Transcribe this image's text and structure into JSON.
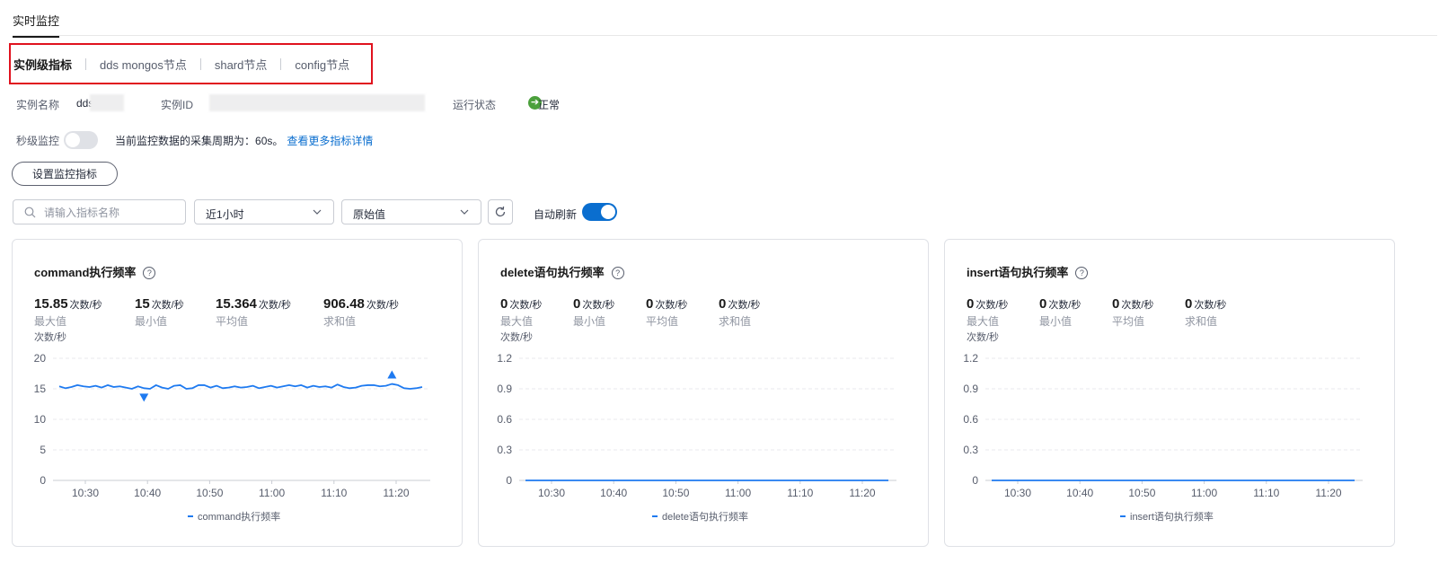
{
  "page_tab": "实时监控",
  "subtabs": [
    "实例级指标",
    "dds mongos节点",
    "shard节点",
    "config节点"
  ],
  "info": {
    "name_label": "实例名称",
    "name_value": "dds",
    "id_label": "实例ID",
    "status_label": "运行状态",
    "status_value": "正常"
  },
  "second_level": {
    "label": "秒级监控",
    "period_text": "当前监控数据的采集周期为：60s。",
    "link_text": "查看更多指标详情"
  },
  "setting_button": "设置监控指标",
  "search": {
    "placeholder": "请输入指标名称"
  },
  "time_select": "近1小时",
  "value_select": "原始值",
  "auto_refresh_label": "自动刷新",
  "colors": {
    "accent": "#0a6ecf",
    "series": "#1e7af0",
    "status_ok": "#4ba03c",
    "highlight_border": "#e0121e"
  },
  "cards": [
    {
      "title": "command执行频率",
      "stats": [
        {
          "value": "15.85",
          "unit": "次数/秒",
          "label": "最大值"
        },
        {
          "value": "15",
          "unit": "次数/秒",
          "label": "最小值"
        },
        {
          "value": "15.364",
          "unit": "次数/秒",
          "label": "平均值"
        },
        {
          "value": "906.48",
          "unit": "次数/秒",
          "label": "求和值"
        }
      ],
      "unit_label": "次数/秒",
      "legend": "command执行频率"
    },
    {
      "title": "delete语句执行频率",
      "stats": [
        {
          "value": "0",
          "unit": "次数/秒",
          "label": "最大值"
        },
        {
          "value": "0",
          "unit": "次数/秒",
          "label": "最小值"
        },
        {
          "value": "0",
          "unit": "次数/秒",
          "label": "平均值"
        },
        {
          "value": "0",
          "unit": "次数/秒",
          "label": "求和值"
        }
      ],
      "unit_label": "次数/秒",
      "legend": "delete语句执行频率"
    },
    {
      "title": "insert语句执行频率",
      "stats": [
        {
          "value": "0",
          "unit": "次数/秒",
          "label": "最大值"
        },
        {
          "value": "0",
          "unit": "次数/秒",
          "label": "最小值"
        },
        {
          "value": "0",
          "unit": "次数/秒",
          "label": "平均值"
        },
        {
          "value": "0",
          "unit": "次数/秒",
          "label": "求和值"
        }
      ],
      "unit_label": "次数/秒",
      "legend": "insert语句执行频率"
    }
  ],
  "chart_data": [
    {
      "type": "line",
      "ylim": [
        0,
        20
      ],
      "yticks": [
        "0",
        "5",
        "10",
        "15",
        "20"
      ],
      "xticks": [
        "10:30",
        "10:40",
        "10:50",
        "11:00",
        "11:10",
        "11:20"
      ],
      "series": [
        {
          "name": "command执行频率",
          "values": [
            15.4,
            15.1,
            15.3,
            15.6,
            15.4,
            15.3,
            15.5,
            15.2,
            15.6,
            15.3,
            15.4,
            15.2,
            15.0,
            15.4,
            15.1,
            15.0,
            15.6,
            15.2,
            15.0,
            15.5,
            15.6,
            15.0,
            15.1,
            15.6,
            15.6,
            15.2,
            15.5,
            15.1,
            15.2,
            15.4,
            15.2,
            15.3,
            15.5,
            15.1,
            15.3,
            15.5,
            15.2,
            15.4,
            15.6,
            15.4,
            15.6,
            15.2,
            15.5,
            15.3,
            15.4,
            15.2,
            15.7,
            15.3,
            15.1,
            15.2,
            15.5,
            15.6,
            15.6,
            15.4,
            15.5,
            15.8,
            15.6,
            15.1,
            15.0,
            15.1,
            15.3
          ]
        }
      ],
      "max_marker_index": 55,
      "min_marker_index": 14
    },
    {
      "type": "line",
      "ylim": [
        0,
        1.2
      ],
      "yticks": [
        "0",
        "0.3",
        "0.6",
        "0.9",
        "1.2"
      ],
      "xticks": [
        "10:30",
        "10:40",
        "10:50",
        "11:00",
        "11:10",
        "11:20"
      ],
      "series": [
        {
          "name": "delete语句执行频率",
          "values": [
            0,
            0
          ]
        }
      ]
    },
    {
      "type": "line",
      "ylim": [
        0,
        1.2
      ],
      "yticks": [
        "0",
        "0.3",
        "0.6",
        "0.9",
        "1.2"
      ],
      "xticks": [
        "10:30",
        "10:40",
        "10:50",
        "11:00",
        "11:10",
        "11:20"
      ],
      "series": [
        {
          "name": "insert语句执行频率",
          "values": [
            0,
            0
          ]
        }
      ]
    }
  ]
}
